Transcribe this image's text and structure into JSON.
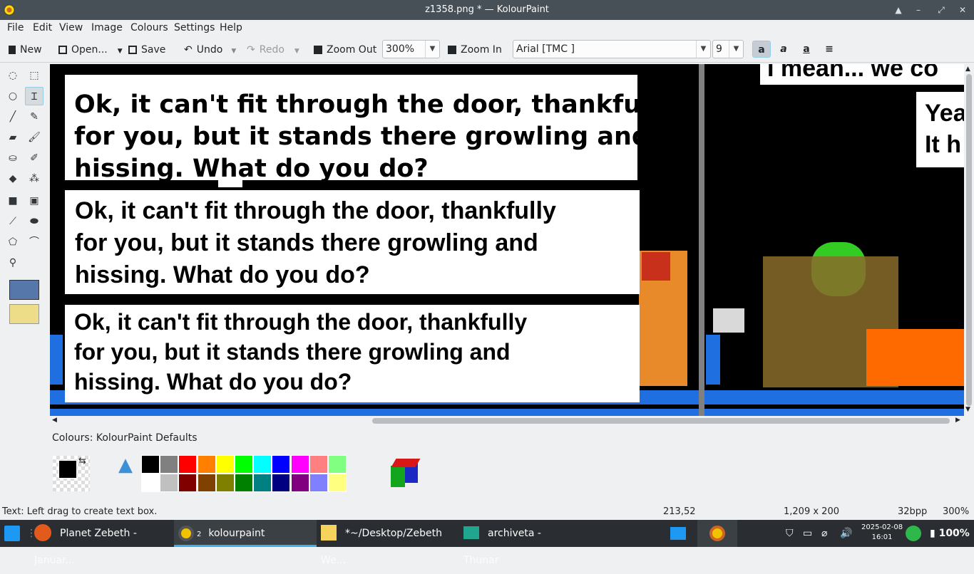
{
  "window": {
    "title": "z1358.png * — KolourPaint",
    "controls": [
      "▲",
      "–",
      "⤢",
      "✕"
    ]
  },
  "menu": [
    "File",
    "Edit",
    "View",
    "Image",
    "Colours",
    "Settings",
    "Help"
  ],
  "toolbar": {
    "new": "New",
    "open": "Open...",
    "save": "Save",
    "undo": "Undo",
    "redo": "Redo",
    "zoom_out": "Zoom Out",
    "zoom_value": "300%",
    "zoom_in": "Zoom In",
    "font": "Arial [TMC ]",
    "font_size": "9"
  },
  "canvas": {
    "bubbles": [
      {
        "text": "Ok, it can't fit through the door, thankfully\nfor you, but it stands there growling and\nhissing. What do you do?"
      },
      {
        "text": "Ok, it can't fit through the door, thankfully\nfor you, but it stands there growling and\nhissing. What do you do?"
      },
      {
        "text": "Ok, it can't fit through the door, thankfully\nfor you, but it stands there growling and\nhissing. What do you do?"
      }
    ],
    "top_right_text": "I mean... we co",
    "right_text": "Yea\nIt h"
  },
  "palette": {
    "label": "Colours: KolourPaint Defaults",
    "row1": [
      "#000000",
      "#808080",
      "#ff0000",
      "#ff8000",
      "#ffff00",
      "#00ff00",
      "#00ffff",
      "#0000ff",
      "#ff00ff",
      "#ff8080",
      "#80ff80"
    ],
    "row2": [
      "#ffffff",
      "#c0c0c0",
      "#800000",
      "#804000",
      "#808000",
      "#008000",
      "#008080",
      "#000080",
      "#800080",
      "#8080ff",
      "#ffff80"
    ]
  },
  "status": {
    "hint": "Text: Left drag to create text box.",
    "coords": "213,52",
    "size": "1,209 x 200",
    "depth": "32bpp",
    "zoom": "300%"
  },
  "taskbar": {
    "tasks": [
      {
        "label": "Planet Zebeth - Januar..."
      },
      {
        "label": "kolourpaint"
      },
      {
        "label": "*~/Desktop/Zebeth We..."
      },
      {
        "label": "archiveta - Thunar"
      }
    ],
    "badge": "2",
    "date": "2025-02-08",
    "time": "16:01",
    "battery": "100%"
  }
}
